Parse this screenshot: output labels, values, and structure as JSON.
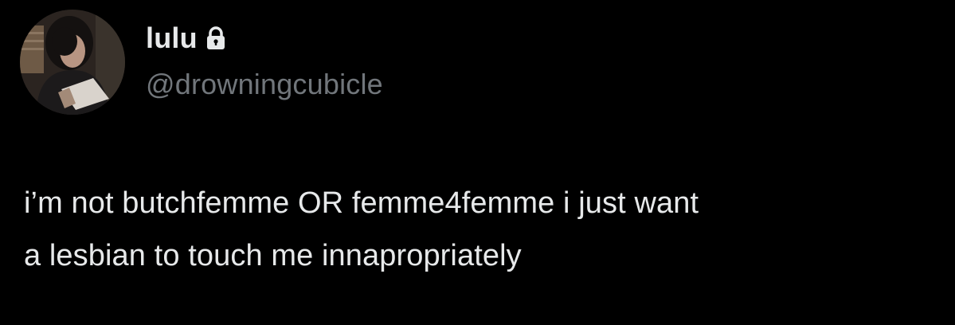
{
  "author": {
    "display_name": "lulu",
    "handle": "@drowningcubicle",
    "protected_icon": "lock-icon",
    "avatar": "profile-photo"
  },
  "tweet": {
    "lines": [
      "i’m not butchfemme OR femme4femme i just want",
      "a lesbian to touch me innapropriately"
    ]
  },
  "colors": {
    "background": "#000000",
    "primary_text": "#e7e9ea",
    "secondary_text": "#71767b"
  }
}
